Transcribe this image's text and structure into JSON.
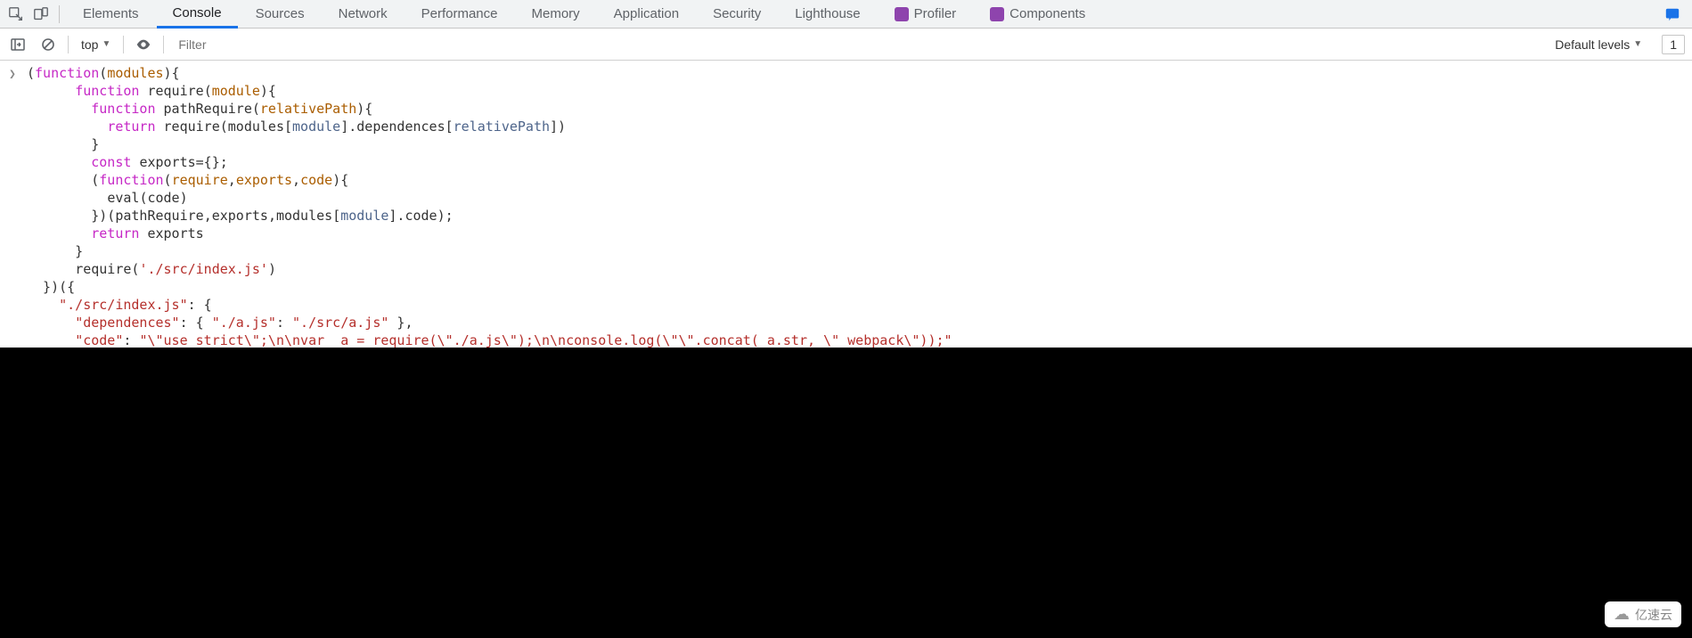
{
  "tabs": {
    "elements": "Elements",
    "console": "Console",
    "sources": "Sources",
    "network": "Network",
    "performance": "Performance",
    "memory": "Memory",
    "application": "Application",
    "security": "Security",
    "lighthouse": "Lighthouse",
    "profiler": "Profiler",
    "components": "Components"
  },
  "toolbar": {
    "context": "top",
    "filter_placeholder": "Filter",
    "levels_label": "Default levels",
    "issue_count": "1"
  },
  "code": {
    "l1a": "(",
    "l1_kw": "function",
    "l1b": "(",
    "l1_param": "modules",
    "l1c": "){",
    "l2a": "      ",
    "l2_kw": "function",
    "l2b": " ",
    "l2_name": "require",
    "l2c": "(",
    "l2_param": "module",
    "l2d": "){",
    "l3a": "        ",
    "l3_kw": "function",
    "l3b": " ",
    "l3_name": "pathRequire",
    "l3c": "(",
    "l3_param": "relativePath",
    "l3d": "){",
    "l4a": "          ",
    "l4_kw": "return",
    "l4b": " ",
    "l4_name": "require",
    "l4c": "(",
    "l4_m1": "modules",
    "l4d": "[",
    "l4_m2": "module",
    "l4e": "].",
    "l4_m3": "dependences",
    "l4f": "[",
    "l4_m4": "relativePath",
    "l4g": "])",
    "l5": "        }",
    "l6a": "        ",
    "l6_kw": "const",
    "l6b": " ",
    "l6_name": "exports",
    "l6c": "={};",
    "l7a": "        (",
    "l7_kw": "function",
    "l7b": "(",
    "l7_p1": "require",
    "l7c": ",",
    "l7_p2": "exports",
    "l7d": ",",
    "l7_p3": "code",
    "l7e": "){",
    "l8a": "          ",
    "l8_name": "eval",
    "l8b": "(",
    "l8_p": "code",
    "l8c": ")",
    "l9a": "        })(",
    "l9_p1": "pathRequire",
    "l9b": ",",
    "l9_p2": "exports",
    "l9c": ",",
    "l9_p3": "modules",
    "l9d": "[",
    "l9_p4": "module",
    "l9e": "].",
    "l9_p5": "code",
    "l9f": ");",
    "l10a": "        ",
    "l10_kw": "return",
    "l10b": " ",
    "l10_name": "exports",
    "l11": "      }",
    "l12a": "      ",
    "l12_name": "require",
    "l12b": "(",
    "l12_str": "'./src/index.js'",
    "l12c": ")",
    "l13": "  })({",
    "l14a": "    ",
    "l14_str": "\"./src/index.js\"",
    "l14b": ": {",
    "l15a": "      ",
    "l15_k": "\"dependences\"",
    "l15b": ": { ",
    "l15_k2": "\"./a.js\"",
    "l15c": ": ",
    "l15_v": "\"./src/a.js\"",
    "l15d": " },",
    "l16a": "      ",
    "l16_k": "\"code\"",
    "l16b": ": ",
    "l16_v": "\"\\\"use strict\\\";\\n\\nvar _a = require(\\\"./a.js\\\");\\n\\nconsole.log(\\\"\\\".concat(_a.str, \\\" webpack\\\"));\""
  },
  "watermark": {
    "text": "亿速云"
  }
}
